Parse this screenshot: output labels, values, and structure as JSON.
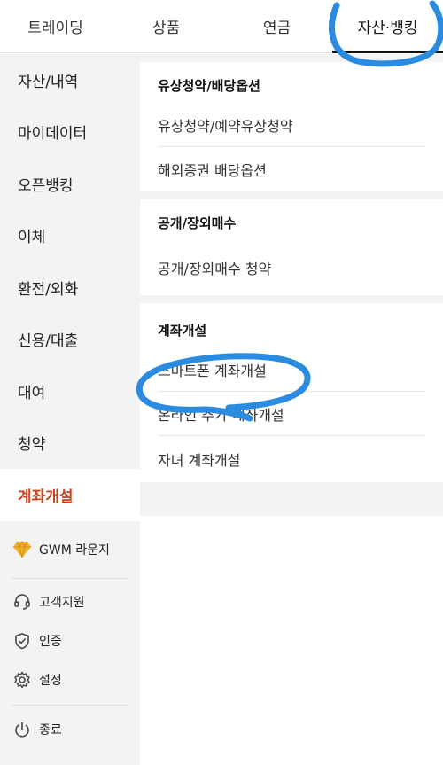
{
  "top_tabs": [
    {
      "label": "트레이딩"
    },
    {
      "label": "상품"
    },
    {
      "label": "연금"
    },
    {
      "label": "자산·뱅킹"
    }
  ],
  "sidebar": {
    "items": [
      {
        "label": "자산/내역"
      },
      {
        "label": "마이데이터"
      },
      {
        "label": "오픈뱅킹"
      },
      {
        "label": "이체"
      },
      {
        "label": "환전/외화"
      },
      {
        "label": "신용/대출"
      },
      {
        "label": "대여"
      },
      {
        "label": "청약"
      },
      {
        "label": "계좌개설"
      }
    ],
    "gwm_lounge": "GWM 라운지",
    "customer_support": "고객지원",
    "certification": "인증",
    "settings": "설정",
    "exit": "종료"
  },
  "sections": [
    {
      "title": "유상청약/배당옵션",
      "items": [
        "유상청약/예약유상청약",
        "해외증권 배당옵션"
      ]
    },
    {
      "title": "공개/장외매수",
      "items": [
        "공개/장외매수 청약"
      ]
    },
    {
      "title": "계좌개설",
      "items": [
        "스마트폰 계좌개설",
        "온라인 추가 계좌개설",
        "자녀 계좌개설"
      ]
    }
  ],
  "colors": {
    "active_accent": "#c8451d",
    "annotation_blue": "#2a8be0",
    "gem": "#f0b429"
  },
  "icons": [
    "diamond-icon",
    "headset-icon",
    "shield-check-icon",
    "gear-icon",
    "power-icon"
  ]
}
